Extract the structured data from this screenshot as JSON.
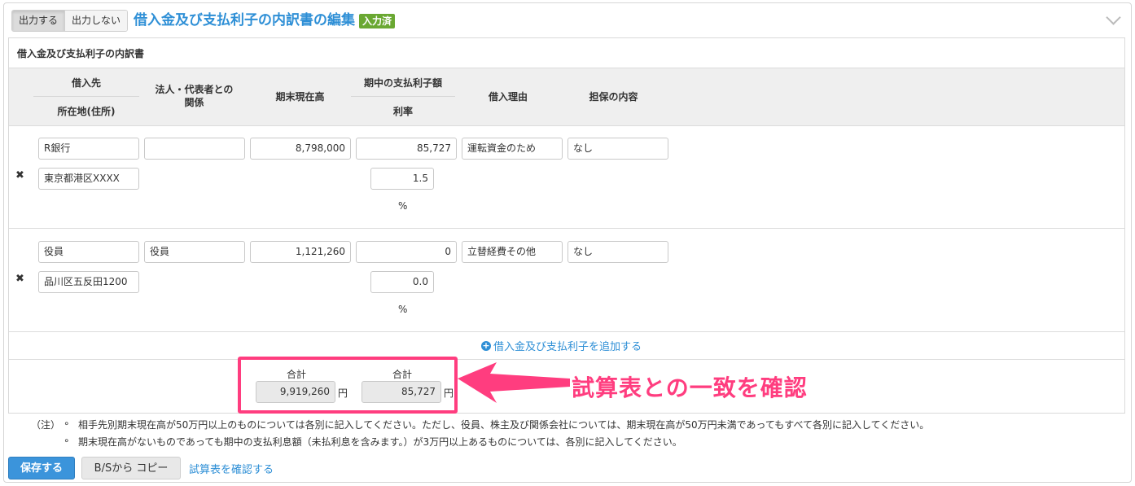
{
  "header": {
    "output_on": "出力する",
    "output_off": "出力しない",
    "title": "借入金及び支払利子の内訳書の編集",
    "status_badge": "入力済"
  },
  "section": {
    "title": "借入金及び支払利子の内訳書",
    "columns": {
      "lender": "借入先",
      "address": "所在地(住所)",
      "relation_line1": "法人・代表者との",
      "relation_line2": "関係",
      "balance": "期末現在高",
      "interest_paid": "期中の支払利子額",
      "rate": "利率",
      "reason": "借入理由",
      "collateral": "担保の内容"
    },
    "rows": [
      {
        "lender": "R銀行",
        "address": "東京都港区XXXX",
        "relation": "",
        "balance": "8,798,000",
        "interest": "85,727",
        "rate": "1.5",
        "rate_unit": "%",
        "reason": "運転資金のため",
        "collateral": "なし"
      },
      {
        "lender": "役員",
        "address": "品川区五反田1200",
        "relation": "役員",
        "balance": "1,121,260",
        "interest": "0",
        "rate": "0.0",
        "rate_unit": "%",
        "reason": "立替経費その他",
        "collateral": "なし"
      }
    ],
    "add_link": "借入金及び支払利子を追加する",
    "totals": {
      "label_balance": "合計",
      "balance": "9,919,260",
      "label_interest": "合計",
      "interest": "85,727",
      "unit": "円"
    },
    "notes": {
      "prefix": "（注）",
      "bullet": "∘",
      "line1": "相手先別期末現在高が50万円以上のものについては各別に記入してください。ただし、役員、株主及び関係会社については、期末現在高が50万円未満であってもすべて各別に記入してください。",
      "line2": "期末現在高がないものであっても期中の支払利息額（未払利息を含みます。）が3万円以上あるものについては、各別に記入してください。"
    }
  },
  "annotation": {
    "text": "試算表との一致を確認",
    "color": "#ff3d7f"
  },
  "footer": {
    "save": "保存する",
    "copy": "B/Sから コピー",
    "check_link": "試算表を確認する"
  }
}
